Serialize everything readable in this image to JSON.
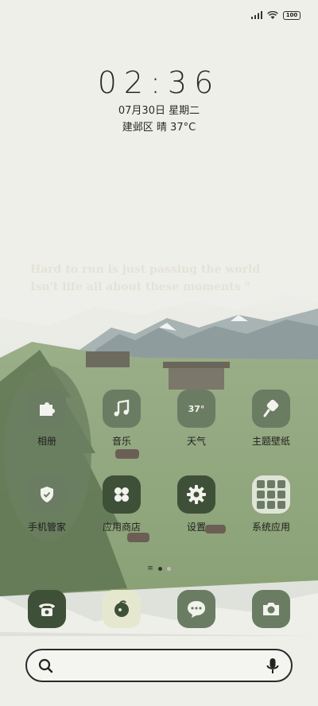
{
  "status_bar": {
    "battery": "100",
    "icons": [
      "signal-icon",
      "wifi-icon",
      "battery-icon"
    ]
  },
  "lockscreen": {
    "time": "02:36",
    "date": "07月30日 星期二",
    "weather": "建邺区 晴 37°C"
  },
  "wallpaper": {
    "quote": "Hard to run is just passing the world Isn't life all about these moments \""
  },
  "apps": [
    {
      "label": "相册",
      "icon": "puzzle-icon"
    },
    {
      "label": "音乐",
      "icon": "music-note-icon"
    },
    {
      "label": "天气",
      "icon": "weather-icon",
      "badge": "37°"
    },
    {
      "label": "主题壁纸",
      "icon": "paint-brush-icon"
    },
    {
      "label": "手机管家",
      "icon": "shield-check-icon"
    },
    {
      "label": "应用商店",
      "icon": "app-store-icon"
    },
    {
      "label": "设置",
      "icon": "gear-icon"
    },
    {
      "label": "系统应用",
      "icon": "folder-icon"
    }
  ],
  "dock": [
    {
      "icon": "phone-icon"
    },
    {
      "icon": "browser-icon"
    },
    {
      "icon": "message-icon"
    },
    {
      "icon": "camera-icon"
    }
  ],
  "page_indicator": {
    "pages": 2,
    "active": 1
  },
  "search": {
    "icons": [
      "search-icon",
      "microphone-icon"
    ]
  },
  "colors": {
    "tile_dark": "#3f5038",
    "tile_mid": "#6a7d63",
    "background": "#efefea"
  }
}
